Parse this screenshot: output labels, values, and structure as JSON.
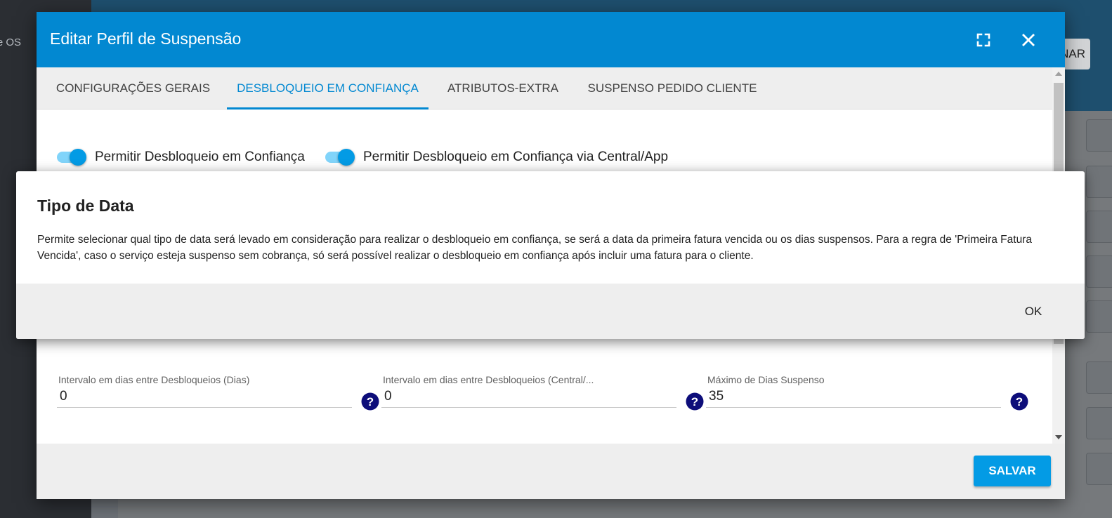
{
  "background": {
    "sidebar_text": "e OS",
    "header_button_label": "NAR"
  },
  "dialog": {
    "title": "Editar Perfil de Suspensão",
    "fullscreen_icon": "fullscreen-icon",
    "close_icon": "close-icon",
    "tabs": [
      {
        "label": "CONFIGURAÇÕES GERAIS",
        "active": false
      },
      {
        "label": "DESBLOQUEIO EM CONFIANÇA",
        "active": true
      },
      {
        "label": "ATRIBUTOS-EXTRA",
        "active": false
      },
      {
        "label": "SUSPENSO PEDIDO CLIENTE",
        "active": false
      }
    ],
    "toggles": [
      {
        "label": "Permitir Desbloqueio em Confiança",
        "checked": true
      },
      {
        "label": "Permitir Desbloqueio em Confiança via Central/App",
        "checked": true
      }
    ],
    "fields": [
      {
        "label": "Intervalo em dias entre Desbloqueios (Dias)",
        "value": "0"
      },
      {
        "label": "Intervalo em dias entre Desbloqueios (Central/...",
        "value": "0"
      },
      {
        "label": "Máximo de Dias Suspenso",
        "value": "35"
      }
    ],
    "help_icon": "question-circle-icon",
    "save_label": "SALVAR"
  },
  "info_dialog": {
    "title": "Tipo de Data",
    "text": "Permite selecionar qual tipo de data será levado em consideração para realizar o desbloqueio em confiança, se será a data da primeira fatura vencida ou os dias suspensos. Para a regra de 'Primeira Fatura Vencida', caso o serviço esteja suspenso sem cobrança, só será possível realizar o desbloqueio em confiança após incluir uma fatura para o cliente.",
    "ok_label": "OK"
  },
  "colors": {
    "primary": "#0288d1",
    "toggle_on": "#039be5",
    "help_icon": "#0d0d7a"
  }
}
